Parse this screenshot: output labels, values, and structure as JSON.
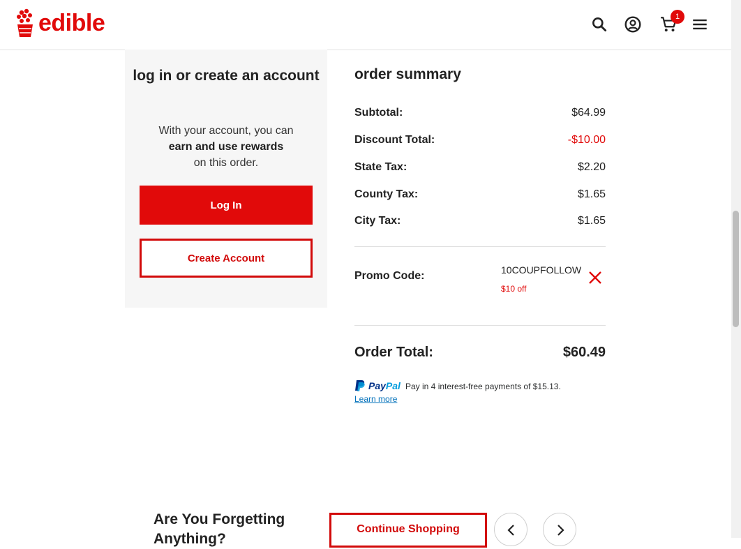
{
  "header": {
    "brand": "edible",
    "cart_count": "1",
    "icons": [
      "edible-logo-icon",
      "search-icon",
      "account-icon",
      "cart-icon",
      "menu-icon"
    ],
    "brand_color": "#e10a0a"
  },
  "account": {
    "title": "log in or create an account",
    "desc_line1": "With your account, you can",
    "desc_bold": "earn and use rewards",
    "desc_line3": "on this order.",
    "login_label": "Log In",
    "create_label": "Create Account"
  },
  "summary": {
    "title": "order summary",
    "rows": [
      {
        "label": "Subtotal:",
        "value": "$64.99"
      },
      {
        "label": "Discount Total:",
        "value": "-$10.00"
      },
      {
        "label": "State Tax:",
        "value": "$2.20"
      },
      {
        "label": "County Tax:",
        "value": "$1.65"
      },
      {
        "label": "City Tax:",
        "value": "$1.65"
      }
    ],
    "promo_label": "Promo Code:",
    "promo_code": "10COUPFOLLOW",
    "promo_note": "$10 off",
    "total_label": "Order Total:",
    "total_value": "$60.49",
    "paypal_word_a": "Pay",
    "paypal_word_b": "Pal",
    "paypal_text": "Pay in 4 interest-free payments of $15.13.",
    "paypal_learn": "Learn more"
  },
  "bottom": {
    "title": "Are You Forgetting Anything?",
    "continue_label": "Continue Shopping"
  }
}
